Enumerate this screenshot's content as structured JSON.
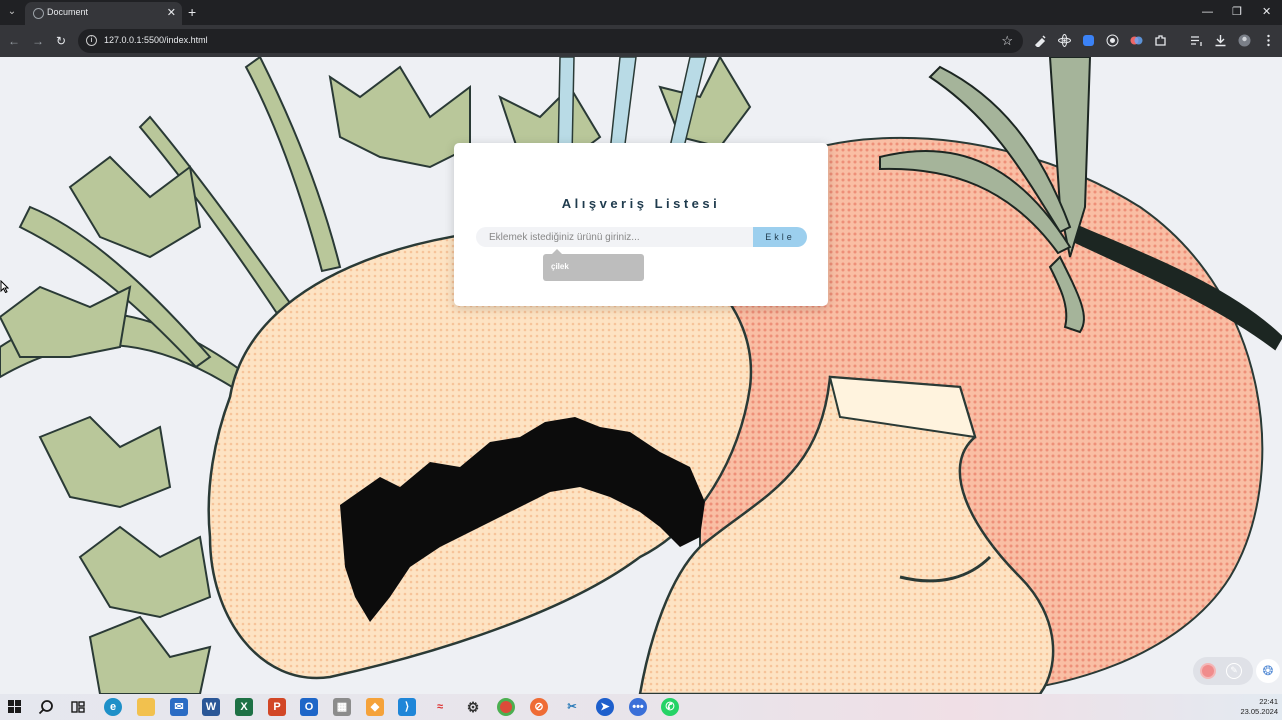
{
  "browser": {
    "tab_title": "Document",
    "url": "127.0.0.1:5500/index.html",
    "menu_glyph": "⌄",
    "close_glyph": "✕",
    "new_tab_glyph": "+",
    "back_glyph": "←",
    "forward_glyph": "→",
    "reload_glyph": "↻",
    "star_glyph": "☆",
    "minimize_glyph": "—",
    "restore_glyph": "❐",
    "window_close_glyph": "✕"
  },
  "app": {
    "title": "Alışveriş Listesi",
    "input_placeholder": "Eklemek istediğiniz ürünü giriniz...",
    "add_label": "Ekle",
    "items": [
      "çilek"
    ]
  },
  "taskbar": {
    "time": "22:41",
    "date": "23.05.2024"
  },
  "colors": {
    "accent": "#9ccfee",
    "title": "#1f3b4d",
    "item_bg": "#bdbdbd"
  }
}
